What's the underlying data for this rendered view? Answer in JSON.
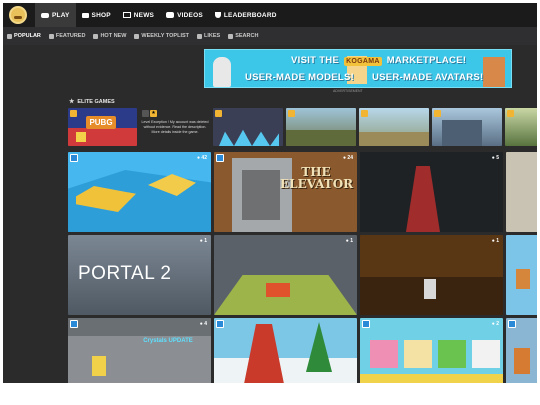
{
  "topnav": {
    "items": [
      {
        "label": "PLAY",
        "icon": "gamepad-icon",
        "active": true
      },
      {
        "label": "SHOP",
        "icon": "cart-icon"
      },
      {
        "label": "NEWS",
        "icon": "news-icon"
      },
      {
        "label": "VIDEOS",
        "icon": "video-icon"
      },
      {
        "label": "LEADERBOARD",
        "icon": "trophy-icon"
      }
    ]
  },
  "subnav": {
    "items": [
      {
        "label": "POPULAR",
        "icon": "gamepad-icon"
      },
      {
        "label": "FEATURED",
        "icon": "rocket-icon"
      },
      {
        "label": "HOT NEW",
        "icon": "home-icon"
      },
      {
        "label": "WEEKLY TOPLIST",
        "icon": "trophy-icon"
      },
      {
        "label": "LIKES",
        "icon": "heart-icon"
      },
      {
        "label": "SEARCH",
        "icon": "search-icon"
      }
    ]
  },
  "banner": {
    "line1_before": "VISIT THE",
    "brand": "KOGAMA",
    "line1_after": "MARKETPLACE!",
    "line2_left": "USER-MADE MODELS!",
    "line2_right": "USER-MADE AVATARS!",
    "ad_label": "ADVERTISEMENT"
  },
  "section": {
    "title": "ELITE GAMES"
  },
  "elite_row": [
    {
      "caption": "PUBG",
      "bg": "#2a2f6a"
    },
    {
      "deleted": "Level Exception ! My account was deleted without evidence. Read the description. More details inside the game."
    },
    {
      "bg": "#3f5fa2"
    },
    {
      "bg": "#6d6a4c"
    },
    {
      "bg": "#7fa6b8"
    },
    {
      "bg": "#4d6b86"
    },
    {
      "bg": "#5c7e4f"
    }
  ],
  "tiles": [
    {
      "count": "42"
    },
    {
      "count": "24",
      "caption": "THE ELEVATOR"
    },
    {
      "count": "5"
    },
    {
      "count": ""
    },
    {
      "count": "1",
      "caption": "PORTAL 2"
    },
    {
      "count": "1"
    },
    {
      "count": "1"
    },
    {
      "count": ""
    },
    {
      "count": "4",
      "caption": "Crystals UPDATE"
    },
    {
      "count": ""
    },
    {
      "count": "2"
    },
    {
      "count": ""
    }
  ]
}
